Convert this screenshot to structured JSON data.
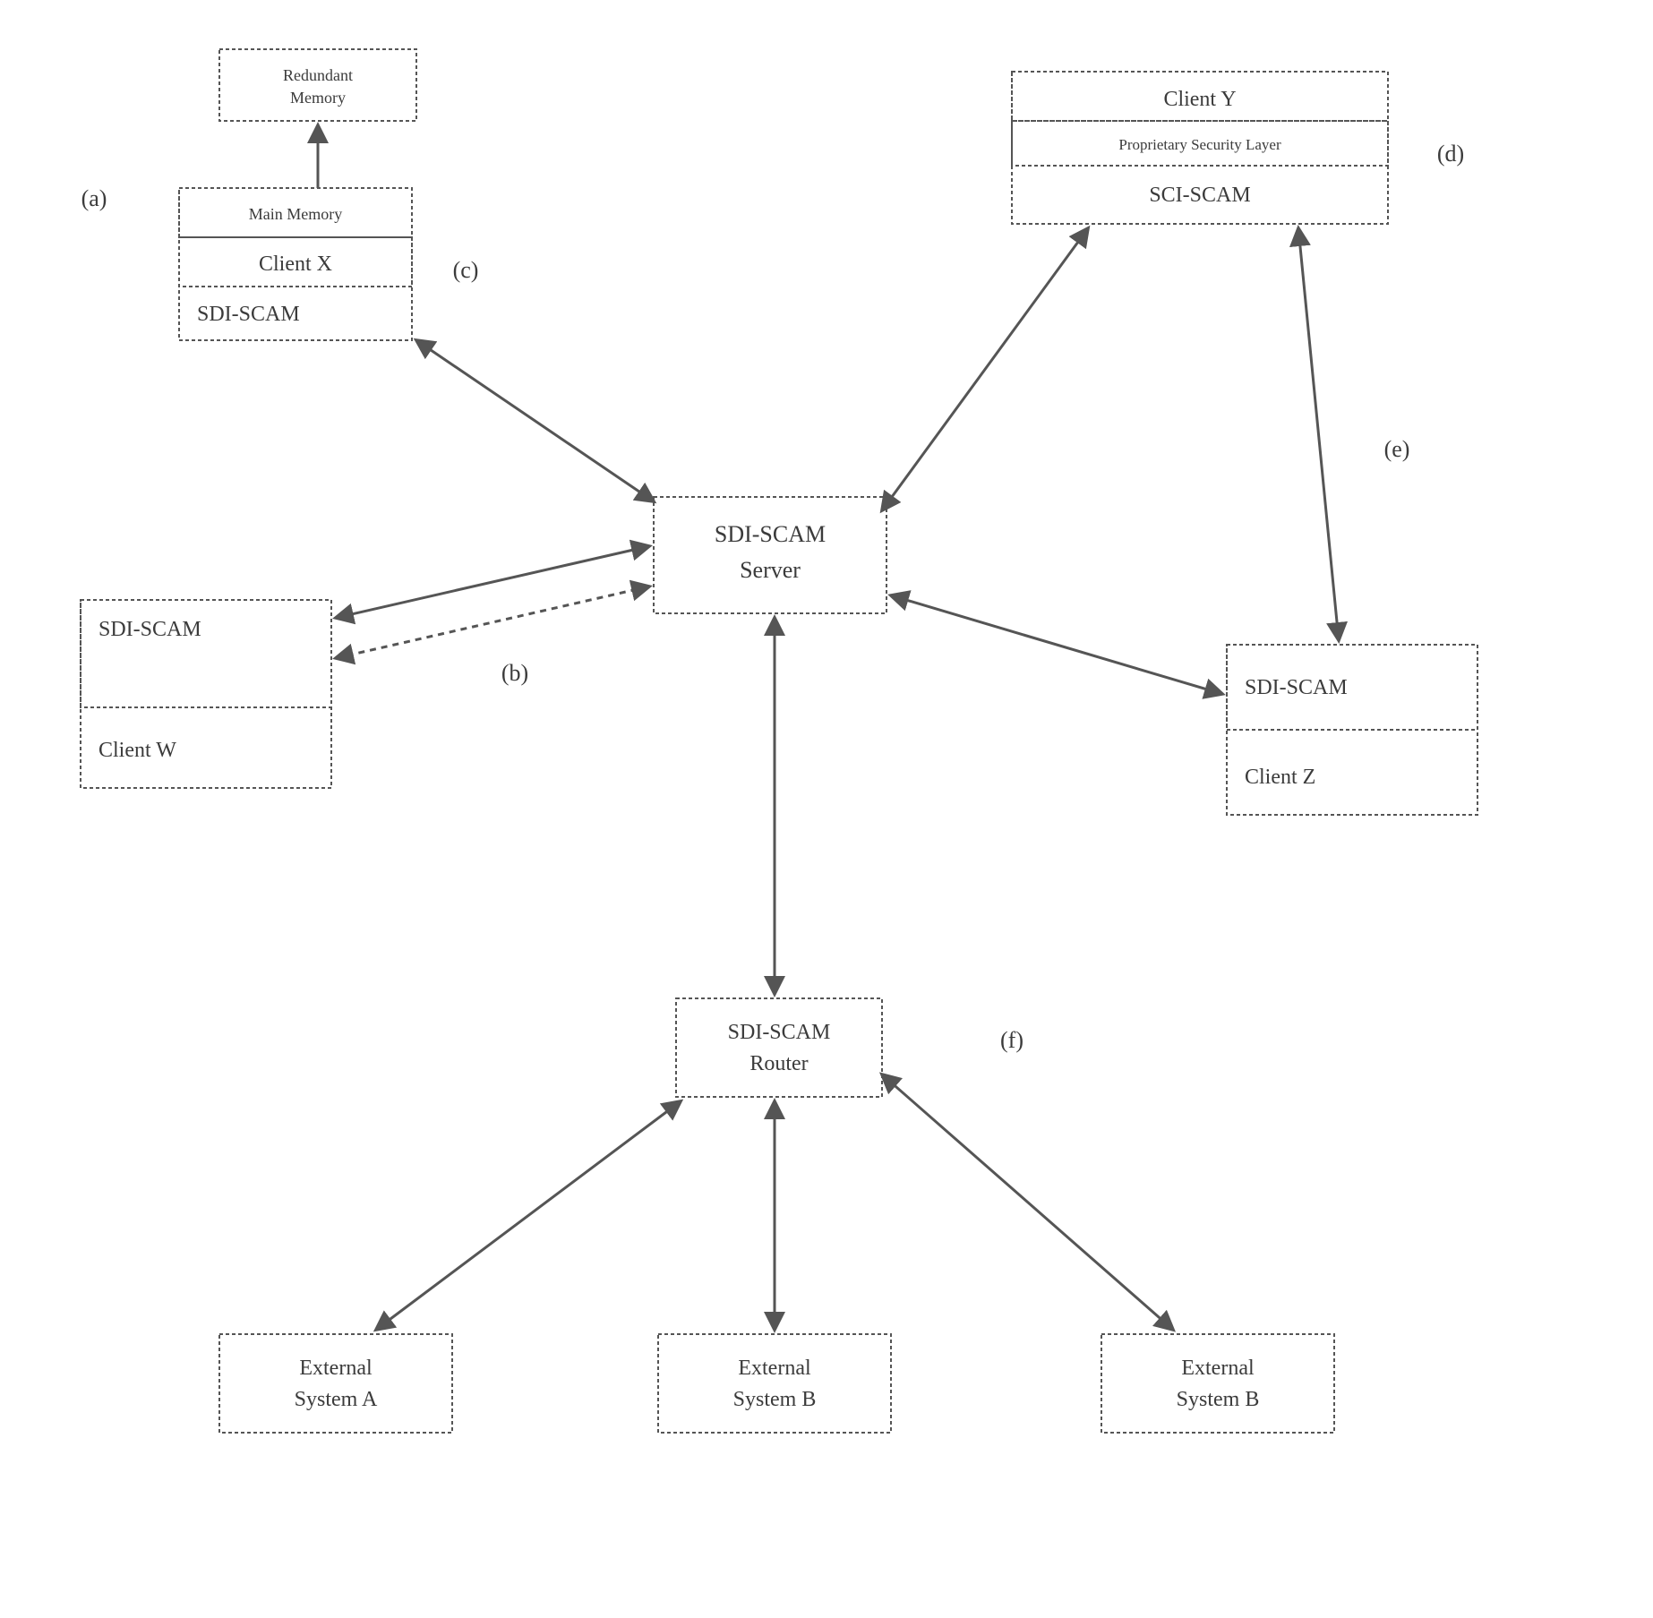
{
  "diagram": {
    "nodes": {
      "redundantMemory": {
        "line1": "Redundant",
        "line2": "Memory"
      },
      "clientX": {
        "mainMemory": "Main Memory",
        "client": "Client X",
        "scam": "SDI-SCAM"
      },
      "clientW": {
        "scam": "SDI-SCAM",
        "client": "Client W"
      },
      "clientY": {
        "client": "Client Y",
        "security": "Proprietary Security Layer",
        "scam": "SCI-SCAM"
      },
      "clientZ": {
        "scam": "SDI-SCAM",
        "client": "Client Z"
      },
      "server": {
        "line1": "SDI-SCAM",
        "line2": "Server"
      },
      "router": {
        "line1": "SDI-SCAM",
        "line2": "Router"
      },
      "extA": {
        "line1": "External",
        "line2": "System A"
      },
      "extB1": {
        "line1": "External",
        "line2": "System B"
      },
      "extB2": {
        "line1": "External",
        "line2": "System B"
      }
    },
    "labels": {
      "a": "(a)",
      "b": "(b)",
      "c": "(c)",
      "d": "(d)",
      "e": "(e)",
      "f": "(f)"
    }
  }
}
